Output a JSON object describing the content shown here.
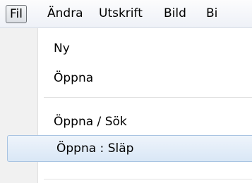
{
  "menubar": {
    "items": [
      {
        "label": "Fil"
      },
      {
        "label": "Ändra"
      },
      {
        "label": "Utskrift"
      },
      {
        "label": "Bild"
      },
      {
        "label": "Bi"
      }
    ]
  },
  "menu": {
    "items": [
      {
        "label": "Ny"
      },
      {
        "label": "Öppna"
      },
      {
        "label": "Öppna / Sök"
      },
      {
        "label": "Öppna :  Släp"
      }
    ]
  }
}
